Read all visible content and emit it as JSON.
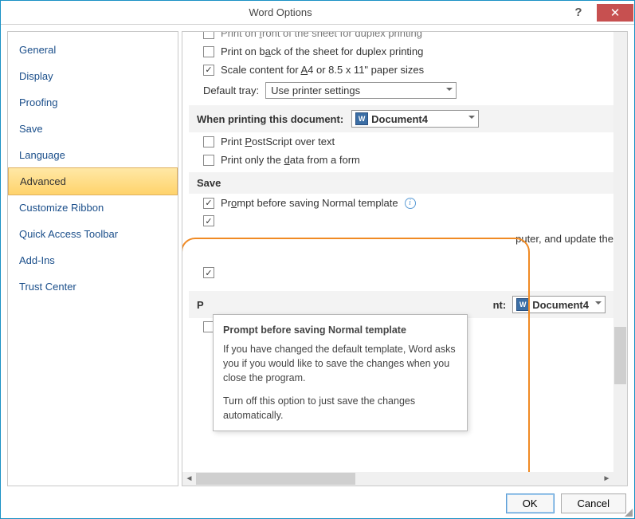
{
  "window": {
    "title": "Word Options"
  },
  "sidebar": {
    "items": [
      {
        "label": "General"
      },
      {
        "label": "Display"
      },
      {
        "label": "Proofing"
      },
      {
        "label": "Save"
      },
      {
        "label": "Language"
      },
      {
        "label": "Advanced",
        "selected": true
      },
      {
        "label": "Customize Ribbon"
      },
      {
        "label": "Quick Access Toolbar"
      },
      {
        "label": "Add-Ins"
      },
      {
        "label": "Trust Center"
      }
    ]
  },
  "content": {
    "opt_front": {
      "pre": "Print on ",
      "u": "f",
      "post": "ront of the sheet for duplex printing"
    },
    "opt_back": {
      "pre": "Print on b",
      "u": "a",
      "post": "ck of the sheet for duplex printing"
    },
    "opt_scale": {
      "pre": "Scale content for ",
      "u": "A",
      "post": "4 or 8.5 x 11\" paper sizes"
    },
    "default_tray_label": "Default tray:",
    "default_tray_value": "Use printer settings",
    "section_print_doc": "When printing this document:",
    "doc_name": "Document4",
    "opt_postscript": {
      "pre": "Print ",
      "u": "P",
      "post": "ostScript over text"
    },
    "opt_formdata": {
      "pre": "Print only the ",
      "u": "d",
      "post": "ata from a form"
    },
    "section_save": "Save",
    "opt_prompt": {
      "pre": "Pr",
      "u": "o",
      "post": "mpt before saving Normal template"
    },
    "partial_right": "puter, and update the",
    "section_presfid": {
      "pre": "P",
      "rest": "nt:"
    },
    "doc_name2": "Document4"
  },
  "tooltip": {
    "title": "Prompt before saving Normal template",
    "p1": "If you have changed the default template, Word asks you if you would like to save the changes when you close the program.",
    "p2": "Turn off this option to just save the changes automatically."
  },
  "buttons": {
    "ok": "OK",
    "cancel": "Cancel"
  }
}
